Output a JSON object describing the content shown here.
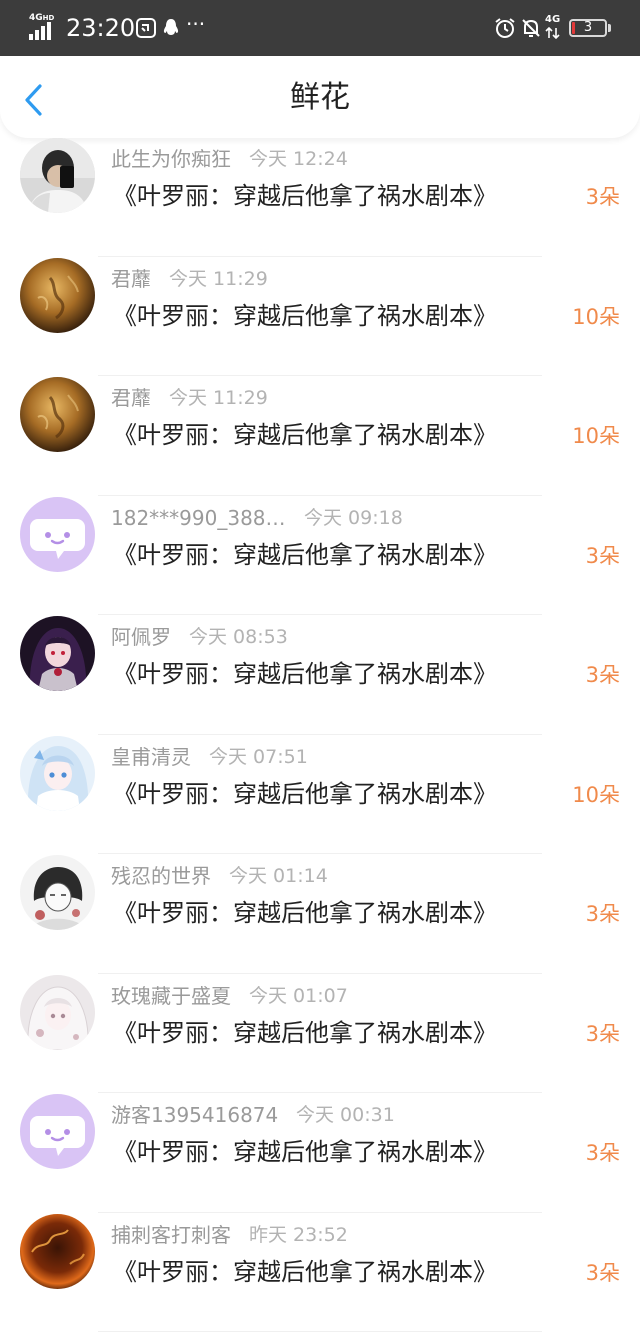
{
  "status_bar": {
    "network": "4G",
    "network_sup": "HD",
    "time": "23:20",
    "battery": "3",
    "battery_level": 0.08,
    "network_right": "4G"
  },
  "header": {
    "title": "鲜花"
  },
  "gifts": [
    {
      "name": "此生为你痴狂",
      "time": "今天 12:24",
      "book": "《叶罗丽：穿越后他拿了祸水剧本》",
      "amount": "3朵",
      "avatar": "user-photo"
    },
    {
      "name": "君蘼",
      "time": "今天 11:29",
      "book": "《叶罗丽：穿越后他拿了祸水剧本》",
      "amount": "10朵",
      "avatar": "golden-texture"
    },
    {
      "name": "君蘼",
      "time": "今天 11:29",
      "book": "《叶罗丽：穿越后他拿了祸水剧本》",
      "amount": "10朵",
      "avatar": "golden-texture"
    },
    {
      "name": "182***990_388…",
      "time": "今天 09:18",
      "book": "《叶罗丽：穿越后他拿了祸水剧本》",
      "amount": "3朵",
      "avatar": "default-chat"
    },
    {
      "name": "阿佩罗",
      "time": "今天 08:53",
      "book": "《叶罗丽：穿越后他拿了祸水剧本》",
      "amount": "3朵",
      "avatar": "anime-dark"
    },
    {
      "name": "皇甫清灵",
      "time": "今天 07:51",
      "book": "《叶罗丽：穿越后他拿了祸水剧本》",
      "amount": "10朵",
      "avatar": "anime-light"
    },
    {
      "name": "残忍的世界",
      "time": "今天 01:14",
      "book": "《叶罗丽：穿越后他拿了祸水剧本》",
      "amount": "3朵",
      "avatar": "anime-sketch"
    },
    {
      "name": "玫瑰藏于盛夏",
      "time": "今天 01:07",
      "book": "《叶罗丽：穿越后他拿了祸水剧本》",
      "amount": "3朵",
      "avatar": "anime-white"
    },
    {
      "name": "游客1395416874",
      "time": "今天 00:31",
      "book": "《叶罗丽：穿越后他拿了祸水剧本》",
      "amount": "3朵",
      "avatar": "default-chat"
    },
    {
      "name": "捕刺客打刺客",
      "time": "昨天 23:52",
      "book": "《叶罗丽：穿越后他拿了祸水剧本》",
      "amount": "3朵",
      "avatar": "fire-sphere"
    }
  ],
  "colors": {
    "status_bar_bg": "#3c3c3c",
    "accent_blue": "#2e9bf0",
    "amount_orange": "#f08a4b",
    "name_gray": "#9a9a9a",
    "time_gray": "#b3b3b3",
    "default_avatar_purple": "#d9c4f5"
  }
}
